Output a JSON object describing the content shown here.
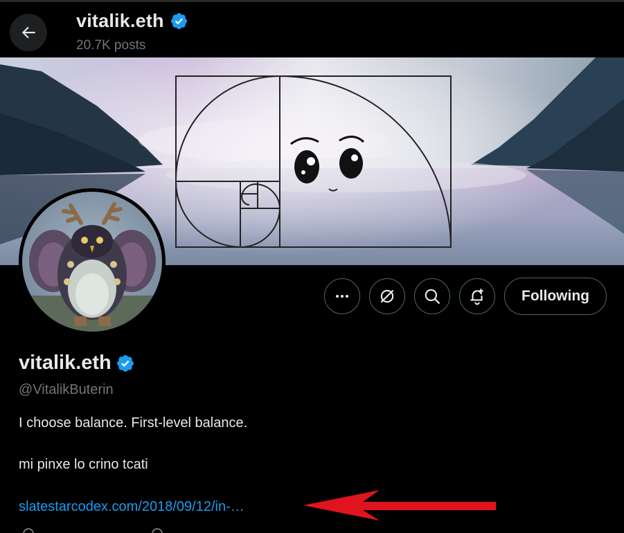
{
  "header": {
    "name": "vitalik.eth",
    "posts": "20.7K posts"
  },
  "profile": {
    "name": "vitalik.eth",
    "handle": "@VitalikButerin",
    "bio_line_1": "I choose balance. First-level balance.",
    "bio_line_2": "mi pinxe lo crino tcati",
    "link": "slatestarcodex.com/2018/09/12/in-…"
  },
  "actions": {
    "more_icon": "more-horizontal-icon",
    "grok_icon": "grok-icon",
    "search_icon": "search-icon",
    "notify_icon": "bell-notification-icon",
    "following_label": "Following"
  },
  "colors": {
    "background": "#000000",
    "text_primary": "#e7e9ea",
    "text_secondary": "#71767b",
    "link": "#1d9bf0",
    "verified": "#1d9bf0",
    "arrow": "#e0141e",
    "button_border": "#536471"
  }
}
